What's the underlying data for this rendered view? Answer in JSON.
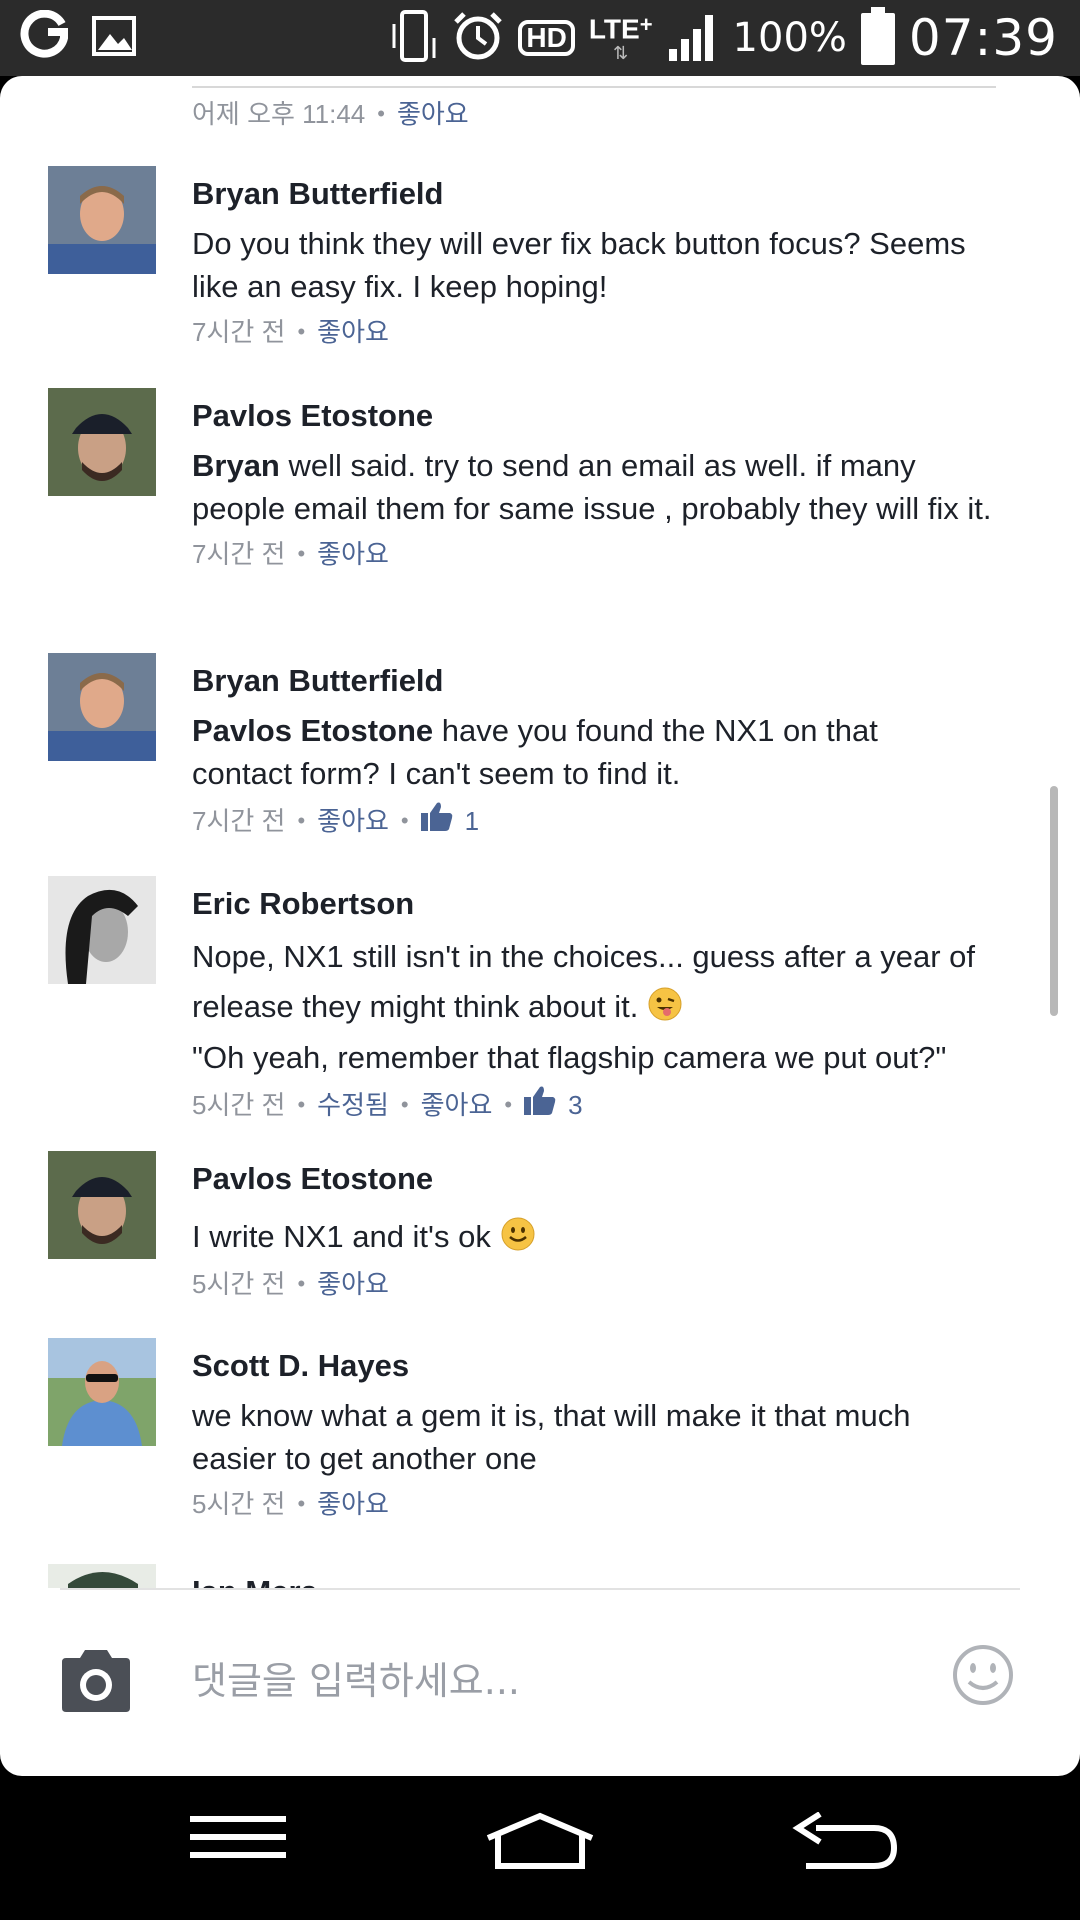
{
  "status_bar": {
    "battery": "100%",
    "time": "07:39",
    "network": "LTE",
    "network_plus": "+",
    "hd": "HD"
  },
  "top_meta": {
    "time": "어제 오후 11:44",
    "like": "좋아요"
  },
  "comments": [
    {
      "name": "Bryan Butterfield",
      "mention": "",
      "text": "Do you think they will ever fix back button focus? Seems like an easy fix. I keep hoping!",
      "time": "7시간 전",
      "like": "좋아요"
    },
    {
      "name": "Pavlos Etostone",
      "mention": "Bryan",
      "text": " well said. try to send an email as well. if many people email them for same issue , probably they will fix it.",
      "time": "7시간 전",
      "like": "좋아요"
    },
    {
      "name": "Bryan Butterfield",
      "mention": "Pavlos Etostone",
      "text": " have you found the NX1 on that contact form? I can't seem to find it.",
      "time": "7시간 전",
      "like": "좋아요",
      "like_count": "1"
    },
    {
      "name": "Eric Robertson",
      "mention": "",
      "text": "Nope, NX1 still isn't in the choices... guess after a year of release they might think about it.",
      "text2": "\"Oh yeah, remember that flagship camera we put out?\"",
      "time": "5시간 전",
      "edited": "수정됨",
      "like": "좋아요",
      "like_count": "3"
    },
    {
      "name": "Pavlos Etostone",
      "mention": "",
      "text": "I write NX1 and it's ok",
      "time": "5시간 전",
      "like": "좋아요"
    },
    {
      "name": "Scott D. Hayes",
      "mention": "",
      "text": "we know what a gem it is, that will make it that much easier to get another one",
      "time": "5시간 전",
      "like": "좋아요"
    },
    {
      "name": "Ian Mera"
    }
  ],
  "composer": {
    "placeholder": "댓글을 입력하세요..."
  },
  "icons": {
    "app_logo": "app-logo-icon",
    "gallery": "image-icon",
    "vibrate": "vibrate-icon",
    "alarm": "alarm-icon",
    "signal": "signal-icon",
    "battery": "battery-icon",
    "camera": "camera-icon",
    "emoji": "smiley-icon",
    "thumb": "thumbs-up-icon",
    "menu": "menu-icon",
    "home": "home-icon",
    "back": "back-icon"
  },
  "colors": {
    "link": "#4b6494",
    "meta": "#90949c",
    "text": "#1d2129",
    "status_bg": "#2b2b2b"
  }
}
